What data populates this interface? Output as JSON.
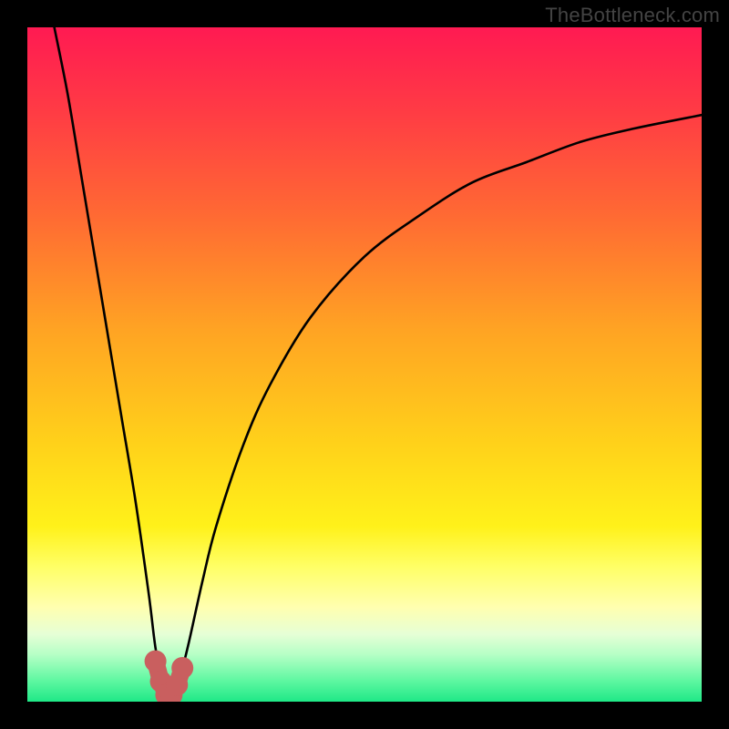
{
  "watermark": "TheBottleneck.com",
  "colors": {
    "frame": "#000000",
    "curve": "#000000",
    "marker": "#c95f5f",
    "gradient_stops": [
      {
        "offset": 0.0,
        "color": "#ff1a52"
      },
      {
        "offset": 0.12,
        "color": "#ff3a45"
      },
      {
        "offset": 0.28,
        "color": "#ff6a33"
      },
      {
        "offset": 0.45,
        "color": "#ffa423"
      },
      {
        "offset": 0.62,
        "color": "#ffd21a"
      },
      {
        "offset": 0.74,
        "color": "#fff11a"
      },
      {
        "offset": 0.8,
        "color": "#ffff66"
      },
      {
        "offset": 0.86,
        "color": "#ffffb0"
      },
      {
        "offset": 0.9,
        "color": "#e6ffd6"
      },
      {
        "offset": 0.93,
        "color": "#b6ffc6"
      },
      {
        "offset": 0.97,
        "color": "#5cf7a0"
      },
      {
        "offset": 1.0,
        "color": "#1fe887"
      }
    ]
  },
  "chart_data": {
    "type": "line",
    "title": "",
    "xlabel": "",
    "ylabel": "",
    "xlim": [
      0,
      100
    ],
    "ylim": [
      0,
      100
    ],
    "grid": false,
    "note": "Bottleneck-style V curve. y≈0 at minimum near x≈21; rises steeply toward 100 on both sides. Values estimated from pixel positions relative to plot area.",
    "series": [
      {
        "name": "bottleneck-curve",
        "x": [
          4,
          6,
          8,
          10,
          12,
          14,
          16,
          18,
          19,
          20,
          21,
          22,
          23,
          24,
          26,
          28,
          32,
          36,
          42,
          50,
          58,
          66,
          74,
          82,
          90,
          100
        ],
        "y": [
          100,
          90,
          78,
          66,
          54,
          42,
          30,
          16,
          8,
          3,
          0,
          2,
          5,
          9,
          18,
          26,
          38,
          47,
          57,
          66,
          72,
          77,
          80,
          83,
          85,
          87
        ]
      }
    ],
    "markers": {
      "name": "minimum-region",
      "x": [
        19.0,
        19.8,
        20.6,
        21.4,
        22.2,
        23.0
      ],
      "y": [
        6,
        3,
        1,
        1,
        2.5,
        5
      ],
      "color": "#c95f5f",
      "size": 12
    }
  }
}
